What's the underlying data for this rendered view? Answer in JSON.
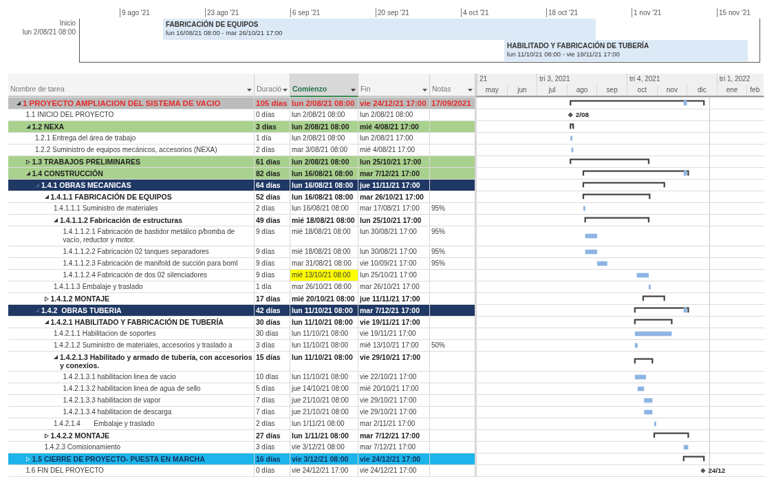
{
  "timeline": {
    "start_label": "Inicio",
    "start_date": "lun 2/08/21 08:00",
    "ticks": [
      "9 ago '21",
      "23 ago '21",
      "6 sep '21",
      "20 sep '21",
      "4 oct '21",
      "18 oct '21",
      "1 nov '21",
      "15 nov '21"
    ],
    "bars": [
      {
        "title": "FABRICACIÓN DE EQUIPOS",
        "dates": "lun 16/08/21 08:00 - mar 26/10/21 17:00"
      },
      {
        "title": "HABILITADO Y FABRICACIÓN DE TUBERÍA",
        "dates": "lun 11/10/21 08:00 - vie 19/11/21 17:00"
      }
    ]
  },
  "table": {
    "columns": [
      {
        "label": "Nombre de tarea",
        "selected": false
      },
      {
        "label": "Duració",
        "selected": false
      },
      {
        "label": "Comienzo",
        "selected": true
      },
      {
        "label": "Fin",
        "selected": false
      },
      {
        "label": "Notas",
        "selected": false
      }
    ],
    "rows": [
      {
        "kind": "project",
        "name": "1 PROYECTO AMPLIACION DEL SISTEMA DE VACIO",
        "duration": "105 días",
        "start": "lun 2/08/21 08:00",
        "finish": "vie 24/12/21 17:00",
        "notes": "17/09/2021",
        "start_highlighted": false,
        "expanded": true,
        "children": [
          {
            "kind": "milestone",
            "name": "1.1 INICIO DEL PROYECTO",
            "duration": "0 días",
            "start": "lun 2/08/21 08:00",
            "finish": "lun 2/08/21 08:00",
            "start_highlighted": false,
            "gantt_label": "2/08"
          },
          {
            "kind": "phase",
            "name": "1.2 NEXA",
            "duration": "3 días",
            "start": "lun 2/08/21 08:00",
            "finish": "mié 4/08/21 17:00",
            "start_highlighted": false,
            "expanded": true,
            "children": [
              {
                "kind": "task",
                "name": "1.2.1 Entrega del área de trabajo",
                "duration": "1 día",
                "start": "lun 2/08/21 08:00",
                "finish": "lun 2/08/21 17:00",
                "start_highlighted": false
              },
              {
                "kind": "task",
                "name": "1.2.2 Suministro de equipos mecánicos, accesorios (NEXA)",
                "duration": "2 días",
                "start": "mar 3/08/21 08:00",
                "finish": "mié 4/08/21 17:00",
                "start_highlighted": false
              }
            ]
          },
          {
            "kind": "phase",
            "name": "1.3 TRABAJOS PRELIMINARES",
            "duration": "61 días",
            "start": "lun 2/08/21 08:00",
            "finish": "lun 25/10/21 17:00",
            "start_highlighted": false,
            "expanded": false
          },
          {
            "kind": "phase",
            "name": "1.4 CONSTRUCCIÓN",
            "duration": "82 días",
            "start": "lun 16/08/21 08:00",
            "finish": "mar 7/12/21 17:00",
            "start_highlighted": false,
            "expanded": true,
            "children": [
              {
                "kind": "section",
                "name": "1.4.1 OBRAS MECANICAS",
                "duration": "64 días",
                "start": "lun 16/08/21 08:00",
                "finish": "jue 11/11/21 17:00",
                "start_highlighted": false,
                "expanded": true,
                "children": [
                  {
                    "kind": "summary",
                    "name": "1.4.1.1 FABRICACIÓN DE EQUIPOS",
                    "duration": "52 días",
                    "start": "lun 16/08/21 08:00",
                    "finish": "mar 26/10/21 17:00",
                    "start_highlighted": false,
                    "expanded": true,
                    "children": [
                      {
                        "kind": "task",
                        "name": "1.4.1.1.1 Suministro de materiales",
                        "duration": "2 días",
                        "start": "lun 16/08/21 08:00",
                        "finish": "mar 17/08/21 17:00",
                        "notes": "95%",
                        "start_highlighted": false
                      },
                      {
                        "kind": "summary",
                        "name": "1.4.1.1.2 Fabricación de estructuras",
                        "duration": "49 días",
                        "start": "mié 18/08/21 08:00",
                        "finish": "lun 25/10/21 17:00",
                        "start_highlighted": false,
                        "expanded": true,
                        "children": [
                          {
                            "kind": "task",
                            "name": "1.4.1.1.2.1 Fabricación de bastidor metálico p/bomba de vacío, reductor y motor.",
                            "duration": "9 días",
                            "start": "mié 18/08/21 08:00",
                            "finish": "lun 30/08/21 17:00",
                            "notes": "95%",
                            "start_highlighted": false
                          },
                          {
                            "kind": "task",
                            "name": "1.4.1.1.2.2 Fabricación 02 tanques separadores",
                            "duration": "9 días",
                            "start": "mié 18/08/21 08:00",
                            "finish": "lun 30/08/21 17:00",
                            "notes": "95%",
                            "start_highlighted": false
                          },
                          {
                            "kind": "task",
                            "name": "1.4.1.1.2.3 Fabricación de manifold de succión para boml",
                            "duration": "9 días",
                            "start": "mar 31/08/21 08:00",
                            "finish": "vie 10/09/21 17:00",
                            "notes": "95%",
                            "start_highlighted": false
                          },
                          {
                            "kind": "task",
                            "name": "1.4.1.1.2.4 Fabricación de dos 02 silenciadores",
                            "duration": "9 días",
                            "start": "mié 13/10/21 08:00",
                            "finish": "lun 25/10/21 17:00",
                            "start_highlighted": true
                          }
                        ]
                      },
                      {
                        "kind": "task",
                        "name": "1.4.1.1.3 Embalaje y traslado",
                        "duration": "1 día",
                        "start": "mar 26/10/21 08:00",
                        "finish": "mar 26/10/21 17:00",
                        "start_highlighted": false
                      }
                    ]
                  },
                  {
                    "kind": "summary",
                    "name": "1.4.1.2 MONTAJE",
                    "duration": "17 días",
                    "start": "mié 20/10/21 08:00",
                    "finish": "jue 11/11/21 17:00",
                    "start_highlighted": false,
                    "expanded": false
                  }
                ]
              },
              {
                "kind": "section",
                "name": "1.4.2  OBRAS TUBERIA",
                "duration": "42 días",
                "start": "lun 11/10/21 08:00",
                "finish": "mar 7/12/21 17:00",
                "start_highlighted": false,
                "expanded": true,
                "children": [
                  {
                    "kind": "summary",
                    "name": "1.4.2.1 HABILITADO Y FABRICACIÓN DE TUBERÍA",
                    "duration": "30 días",
                    "start": "lun 11/10/21 08:00",
                    "finish": "vie 19/11/21 17:00",
                    "start_highlighted": false,
                    "expanded": true,
                    "children": [
                      {
                        "kind": "task",
                        "name": "1.4.2.1.1 Habilitacion de soportes",
                        "duration": "30 días",
                        "start": "lun 11/10/21 08:00",
                        "finish": "vie 19/11/21 17:00",
                        "start_highlighted": false
                      },
                      {
                        "kind": "task",
                        "name": "1.4.2.1.2 Suministro de materiales, accesorios y traslado a",
                        "duration": "3 días",
                        "start": "lun 11/10/21 08:00",
                        "finish": "mié 13/10/21 17:00",
                        "notes": "50%",
                        "start_highlighted": false
                      },
                      {
                        "kind": "summary",
                        "name": "1.4.2.1.3 Habilitado y armado de tubería, con accesorios y conexios.",
                        "duration": "15 días",
                        "start": "lun 11/10/21 08:00",
                        "finish": "vie 29/10/21 17:00",
                        "start_highlighted": false,
                        "expanded": true,
                        "children": [
                          {
                            "kind": "task",
                            "name": "1.4.2.1.3.1 habilitacion linea de vacio",
                            "duration": "10 días",
                            "start": "lun 11/10/21 08:00",
                            "finish": "vie 22/10/21 17:00",
                            "start_highlighted": false
                          },
                          {
                            "kind": "task",
                            "name": "1.4.2.1.3.2 habilitacion linea de agua de sello",
                            "duration": "5 días",
                            "start": "jue 14/10/21 08:00",
                            "finish": "mié 20/10/21 17:00",
                            "start_highlighted": false
                          },
                          {
                            "kind": "task",
                            "name": "1.4.2.1.3.3 habilitacion de vapor",
                            "duration": "7 días",
                            "start": "jue 21/10/21 08:00",
                            "finish": "vie 29/10/21 17:00",
                            "start_highlighted": false
                          },
                          {
                            "kind": "task",
                            "name": "1.4.2.1.3.4 habilitacion de descarga",
                            "duration": "7 días",
                            "start": "jue 21/10/21 08:00",
                            "finish": "vie 29/10/21 17:00",
                            "start_highlighted": false
                          }
                        ]
                      },
                      {
                        "kind": "task",
                        "name": "1.4.2.1.4       Embalaje y traslado",
                        "duration": "2 días",
                        "start": "lun 1/11/21 08:00",
                        "finish": "mar 2/11/21 17:00",
                        "start_highlighted": false
                      }
                    ]
                  },
                  {
                    "kind": "summary",
                    "name": "1.4.2.2 MONTAJE",
                    "duration": "27 días",
                    "start": "lun 1/11/21 08:00",
                    "finish": "mar 7/12/21 17:00",
                    "start_highlighted": false,
                    "expanded": false
                  },
                  {
                    "kind": "task",
                    "name": "1.4.2.3 Comisionamiento",
                    "duration": "3 días",
                    "start": "vie 3/12/21 08:00",
                    "finish": "mar 7/12/21 17:00",
                    "start_highlighted": false
                  }
                ]
              }
            ]
          },
          {
            "kind": "closing",
            "name": "1.5 CIERRE DE PROYECTO- PUESTA EN MARCHA",
            "duration": "16 días",
            "start": "vie 3/12/21 08:00",
            "finish": "vie 24/12/21 17:00",
            "start_highlighted": false,
            "expanded": false
          },
          {
            "kind": "milestone",
            "name": "1.6 FIN DEL PROYECTO",
            "duration": "0 días",
            "start": "vie 24/12/21 17:00",
            "finish": "vie 24/12/21 17:00",
            "start_highlighted": false,
            "gantt_label": "24/12"
          }
        ]
      }
    ]
  },
  "gantt": {
    "quarters": [
      "21",
      "tri 3, 2021",
      "tri 4, 2021",
      "tri 1, 2022"
    ],
    "months": [
      "may",
      "jun",
      "jul",
      "ago",
      "sep",
      "oct",
      "nov",
      "dic",
      "ene",
      "feb"
    ]
  }
}
